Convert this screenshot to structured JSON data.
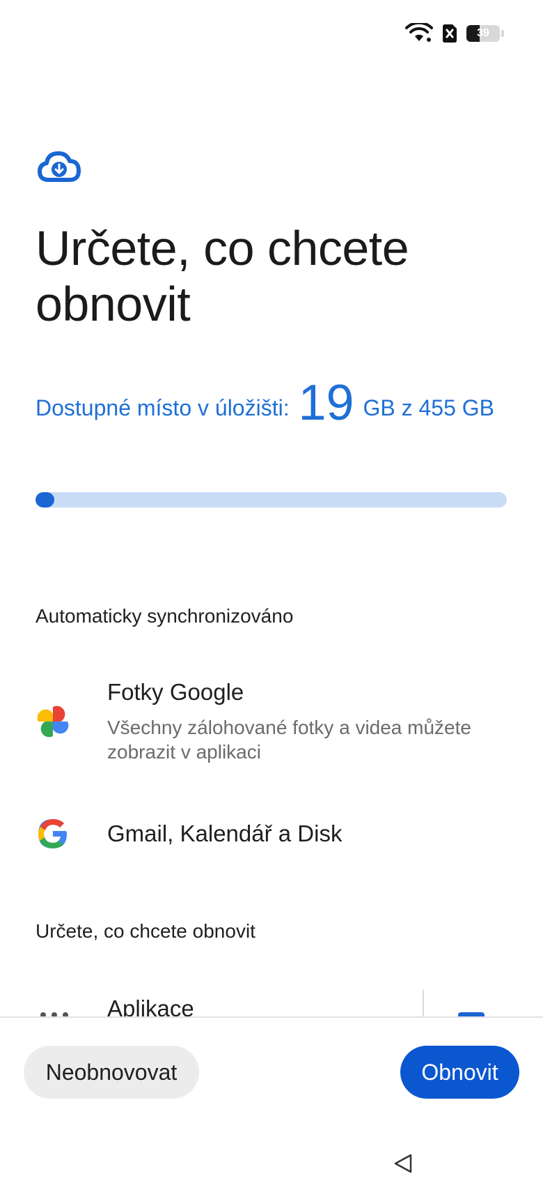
{
  "status_bar": {
    "battery_level": "39",
    "battery_fraction": 0.39,
    "icons": [
      "wifi-icon",
      "no-sim-icon",
      "battery-icon"
    ]
  },
  "header": {
    "icon": "cloud-download-icon",
    "title": "Určete, co chcete obnovit"
  },
  "storage": {
    "prefix": "Dostupné místo v úložišti:",
    "available": "19",
    "suffix": "GB z 455 GB",
    "used_fraction": 0.04,
    "accent_color": "#1a66d2"
  },
  "auto_synced": {
    "label": "Automaticky synchronizováno",
    "items": [
      {
        "icon": "google-photos-icon",
        "title": "Fotky Google",
        "description": "Všechny zálohované fotky a videa můžete zobrazit v aplikaci"
      },
      {
        "icon": "google-icon",
        "title": "Gmail, Kalendář a Disk"
      }
    ]
  },
  "restore_section": {
    "label": "Určete, co chcete obnovit",
    "items": [
      {
        "icon": "apps-icon",
        "title": "Aplikace",
        "checked": true
      }
    ]
  },
  "actions": {
    "skip_label": "Neobnovovat",
    "restore_label": "Obnovit",
    "primary_color": "#0b57d0"
  },
  "nav": {
    "back_icon": "back-triangle-icon"
  }
}
